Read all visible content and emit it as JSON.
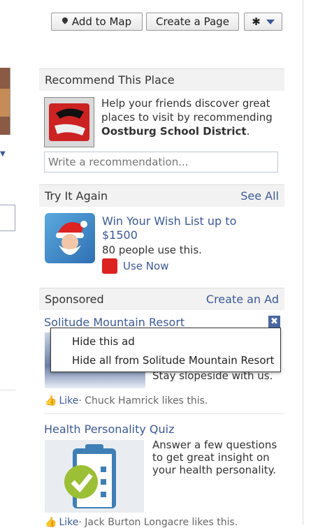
{
  "toolbar": {
    "add_to_map": "Add to Map",
    "create_page": "Create a Page",
    "gear_icon": "gear-icon"
  },
  "recommend": {
    "header": "Recommend This Place",
    "text": "Help your friends discover great places to visit by recommending",
    "place": "Oostburg School District",
    "period": ".",
    "placeholder": "Write a recommendation..."
  },
  "try_again": {
    "header": "Try It Again",
    "see_all": "See All",
    "app_title": "Win Your Wish List up to $1500",
    "users": "80 people use this.",
    "use_now": "Use Now"
  },
  "sponsored": {
    "header": "Sponsored",
    "create_ad": "Create an Ad",
    "ad1": {
      "title": "Solitude Mountain Resort",
      "close": "✖",
      "text": "Stay slopeside with us.",
      "like": "Like",
      "social": "· Chuck Hamrick likes this."
    },
    "menu": {
      "hide_ad": "Hide this ad",
      "hide_all": "Hide all from Solitude Mountain Resort"
    },
    "ad2": {
      "title": "Health Personality Quiz",
      "text": "Answer a few questions to get great insight on your health personality.",
      "like": "Like",
      "social": "· Jack Burton Longacre likes this."
    }
  },
  "colors": {
    "link": "#3b5998",
    "header_bg": "#f2f2f2"
  }
}
